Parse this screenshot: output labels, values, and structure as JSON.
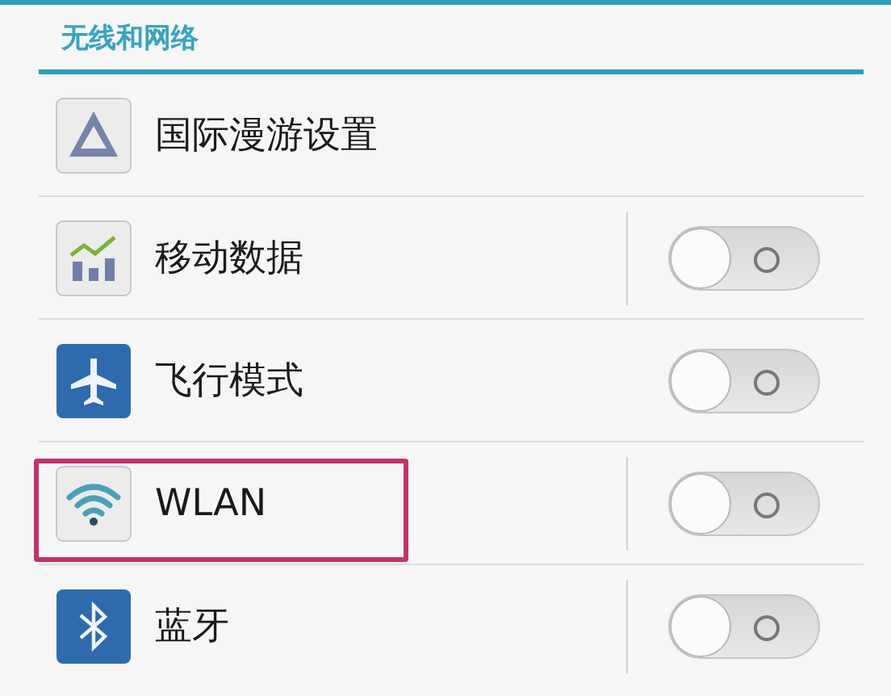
{
  "section": {
    "title": "无线和网络"
  },
  "items": [
    {
      "label": "国际漫游设置",
      "kind": "link",
      "highlighted": false
    },
    {
      "label": "移动数据",
      "kind": "toggle",
      "on": false,
      "separator": true,
      "highlighted": false
    },
    {
      "label": "飞行模式",
      "kind": "toggle",
      "on": false,
      "separator": false,
      "highlighted": false
    },
    {
      "label": "WLAN",
      "kind": "toggle",
      "on": false,
      "separator": true,
      "highlighted": true
    },
    {
      "label": "蓝牙",
      "kind": "toggle",
      "on": false,
      "separator": true,
      "highlighted": false
    }
  ]
}
